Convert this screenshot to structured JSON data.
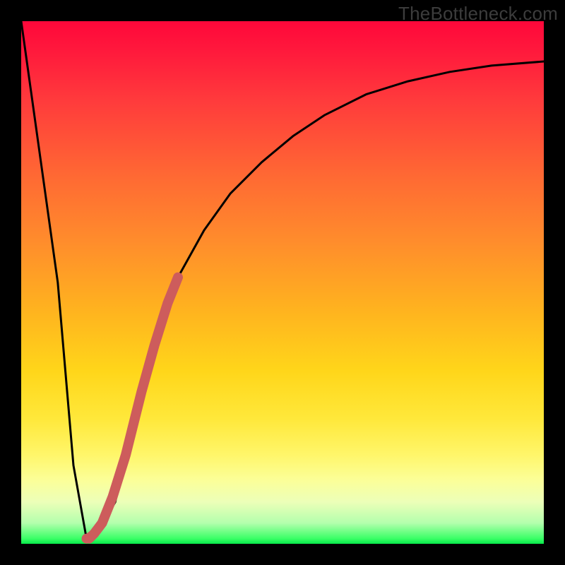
{
  "watermark": "TheBottleneck.com",
  "chart_data": {
    "type": "line",
    "title": "",
    "xlabel": "",
    "ylabel": "",
    "ylim": [
      0,
      100
    ],
    "xlim": [
      0,
      100
    ],
    "series": [
      {
        "name": "bottleneck-curve",
        "x": [
          0,
          7,
          10,
          12.5,
          15,
          18,
          20,
          23,
          26,
          30,
          35,
          40,
          46,
          52,
          58,
          66,
          74,
          82,
          90,
          100
        ],
        "values": [
          100,
          50,
          15,
          1,
          3,
          8,
          17,
          29,
          40,
          51,
          60,
          67,
          73,
          78,
          82,
          86,
          88.5,
          90.3,
          91.5,
          92.3
        ]
      }
    ],
    "highlight_segment": {
      "name": "thick-pink-segment",
      "x": [
        13,
        14,
        15.5,
        17.5,
        20,
        23,
        25.5,
        28,
        30
      ],
      "values": [
        1,
        2,
        4,
        9,
        17,
        29,
        38,
        46,
        51
      ]
    },
    "highlight_dots": {
      "name": "pink-dots-lower",
      "x": [
        12.5,
        13.2,
        14.2
      ],
      "values": [
        1,
        1.4,
        2.5
      ]
    },
    "colors": {
      "curve": "#000000",
      "highlight": "#cd5c5c"
    }
  }
}
